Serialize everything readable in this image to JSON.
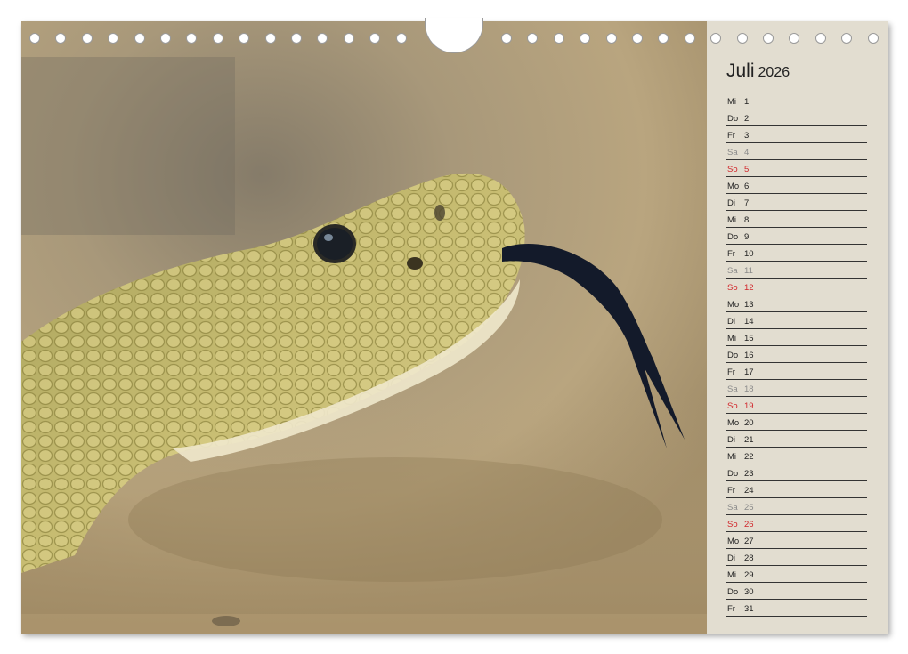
{
  "calendar": {
    "month": "Juli",
    "year": "2026",
    "days": [
      {
        "wd": "Mi",
        "d": "1",
        "type": "normal"
      },
      {
        "wd": "Do",
        "d": "2",
        "type": "normal"
      },
      {
        "wd": "Fr",
        "d": "3",
        "type": "normal"
      },
      {
        "wd": "Sa",
        "d": "4",
        "type": "sa"
      },
      {
        "wd": "So",
        "d": "5",
        "type": "so"
      },
      {
        "wd": "Mo",
        "d": "6",
        "type": "normal"
      },
      {
        "wd": "Di",
        "d": "7",
        "type": "normal"
      },
      {
        "wd": "Mi",
        "d": "8",
        "type": "normal"
      },
      {
        "wd": "Do",
        "d": "9",
        "type": "normal"
      },
      {
        "wd": "Fr",
        "d": "10",
        "type": "normal"
      },
      {
        "wd": "Sa",
        "d": "11",
        "type": "sa"
      },
      {
        "wd": "So",
        "d": "12",
        "type": "so"
      },
      {
        "wd": "Mo",
        "d": "13",
        "type": "normal"
      },
      {
        "wd": "Di",
        "d": "14",
        "type": "normal"
      },
      {
        "wd": "Mi",
        "d": "15",
        "type": "normal"
      },
      {
        "wd": "Do",
        "d": "16",
        "type": "normal"
      },
      {
        "wd": "Fr",
        "d": "17",
        "type": "normal"
      },
      {
        "wd": "Sa",
        "d": "18",
        "type": "sa"
      },
      {
        "wd": "So",
        "d": "19",
        "type": "so"
      },
      {
        "wd": "Mo",
        "d": "20",
        "type": "normal"
      },
      {
        "wd": "Di",
        "d": "21",
        "type": "normal"
      },
      {
        "wd": "Mi",
        "d": "22",
        "type": "normal"
      },
      {
        "wd": "Do",
        "d": "23",
        "type": "normal"
      },
      {
        "wd": "Fr",
        "d": "24",
        "type": "normal"
      },
      {
        "wd": "Sa",
        "d": "25",
        "type": "sa"
      },
      {
        "wd": "So",
        "d": "26",
        "type": "so"
      },
      {
        "wd": "Mo",
        "d": "27",
        "type": "normal"
      },
      {
        "wd": "Di",
        "d": "28",
        "type": "normal"
      },
      {
        "wd": "Mi",
        "d": "29",
        "type": "normal"
      },
      {
        "wd": "Do",
        "d": "30",
        "type": "normal"
      },
      {
        "wd": "Fr",
        "d": "31",
        "type": "normal"
      }
    ]
  },
  "colors": {
    "sunday": "#d1262b",
    "saturday": "#8a8a8a",
    "panel": "#e2ddd0"
  },
  "photo": {
    "subject": "snake-head-with-tongue"
  }
}
